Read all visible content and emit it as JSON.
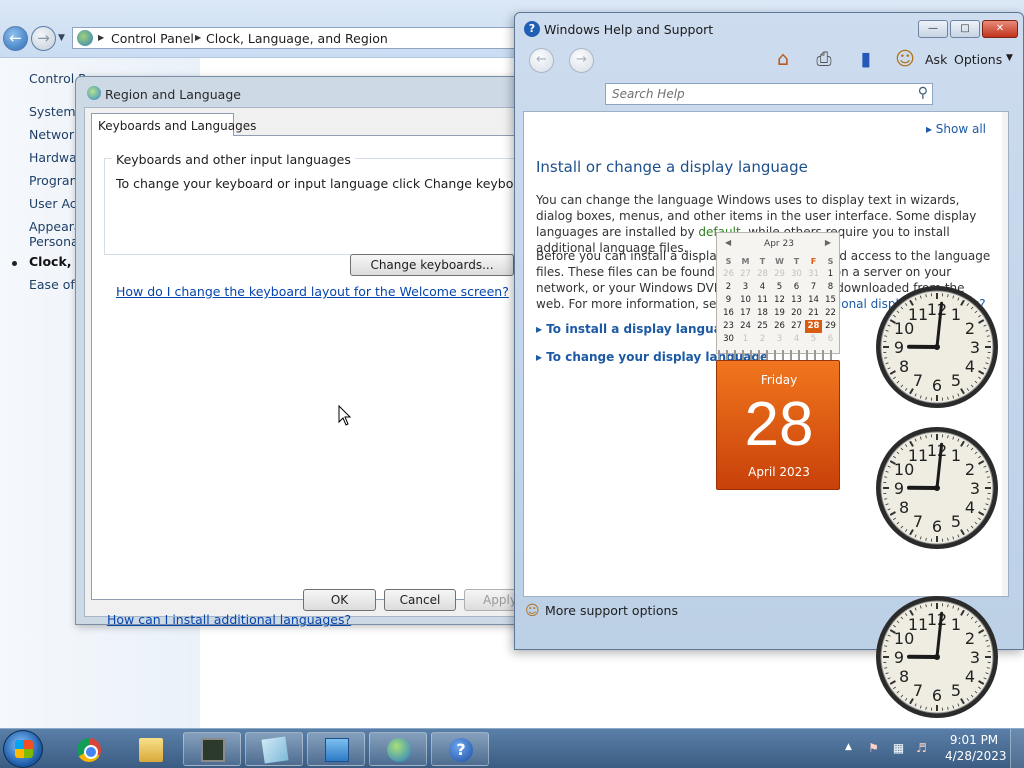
{
  "control_panel": {
    "breadcrumb": [
      "Control Panel",
      "Clock, Language, and Region"
    ],
    "sidebar": [
      {
        "label": "Control Pa",
        "active": false
      },
      {
        "label": "System a",
        "active": false
      },
      {
        "label": "Network",
        "active": false
      },
      {
        "label": "Hardwar",
        "active": false
      },
      {
        "label": "Program",
        "active": false
      },
      {
        "label": "User Acc",
        "active": false
      },
      {
        "label": "Appearan",
        "active": false
      },
      {
        "label": "Personal",
        "active": false
      },
      {
        "label": "Clock, La",
        "active": true
      },
      {
        "label": "Ease of A",
        "active": false
      }
    ]
  },
  "region_dialog": {
    "title": "Region and Language",
    "tab_label": "Keyboards and Languages",
    "group_title": "Keyboards and other input languages",
    "group_desc": "To change your keyboard or input language click Change keyboards.",
    "change_keyboards_label": "Change keyboards...",
    "welcome_link": "How do I change the keyboard layout for the Welcome screen?",
    "install_link": "How can I install additional languages?",
    "ok_label": "OK",
    "cancel_label": "Cancel",
    "apply_label": "Apply"
  },
  "help_window": {
    "title": "Windows Help and Support",
    "toolbar": {
      "ask_label": "Ask",
      "options_label": "Options"
    },
    "search_placeholder": "Search Help",
    "show_all": "Show all",
    "heading": "Install or change a display language",
    "para1_a": "You can change the language Windows uses to display text in wizards, dialog boxes, menus, and other items in the user interface. Some display languages are installed by ",
    "para1_link": "default",
    "para1_b": ", while others require you to install additional language files.",
    "para2_a": "Before you can install a display language, you need access to the language files. These files can be found on your computer, on a server on your network, or your Windows DVD. They can also be downloaded from the web. For more information, see ",
    "para2_link": "How do I get additional display languages?",
    "expand1": "To install a display language",
    "expand2": "To change your display language",
    "more_support": "More support options"
  },
  "calendar_gadget": {
    "month_label": "Apr 23",
    "weekdays": [
      "S",
      "M",
      "T",
      "W",
      "T",
      "F",
      "S"
    ],
    "weeks": [
      [
        26,
        27,
        28,
        29,
        30,
        31,
        1
      ],
      [
        2,
        3,
        4,
        5,
        6,
        7,
        8
      ],
      [
        9,
        10,
        11,
        12,
        13,
        14,
        15
      ],
      [
        16,
        17,
        18,
        19,
        20,
        21,
        22
      ],
      [
        23,
        24,
        25,
        26,
        27,
        28,
        29
      ],
      [
        30,
        1,
        2,
        3,
        4,
        5,
        6
      ]
    ],
    "today": 28,
    "day_name": "Friday",
    "day_number": "28",
    "month_year": "April 2023"
  },
  "clocks": [
    {
      "hour": 9,
      "minute": 1
    },
    {
      "hour": 9,
      "minute": 1
    },
    {
      "hour": 9,
      "minute": 1
    }
  ],
  "taskbar": {
    "time": "9:01 PM",
    "date": "4/28/2023",
    "buttons": [
      "chrome-icon",
      "explorer-icon",
      "monitor-icon",
      "sticky-notes-icon",
      "control-panel-icon",
      "globe-icon",
      "help-icon"
    ]
  }
}
